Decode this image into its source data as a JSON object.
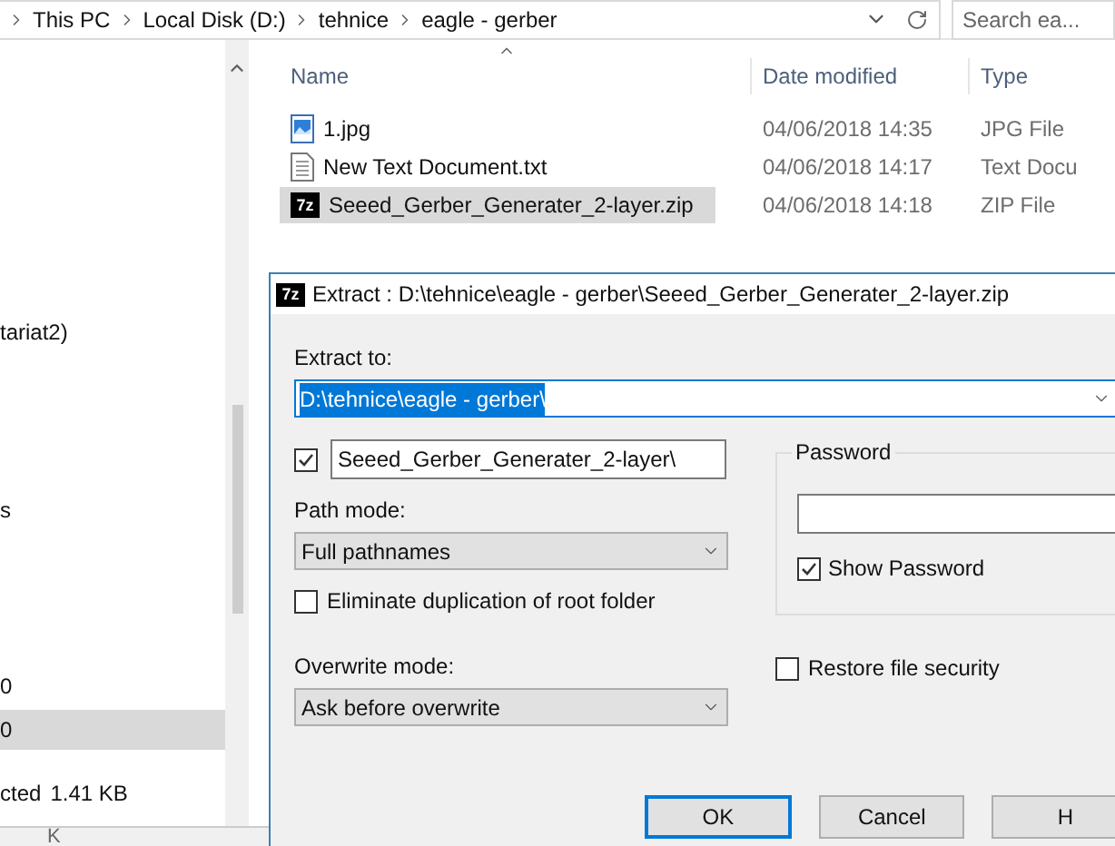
{
  "breadcrumb": [
    "This PC",
    "Local Disk (D:)",
    "tehnice",
    "eagle - gerber"
  ],
  "search": {
    "placeholder": "Search ea..."
  },
  "navigation": {
    "items": [
      {
        "label": "tariat2)",
        "selected": false
      },
      {
        "label": "s",
        "selected": false
      },
      {
        "label": "0",
        "selected": false
      },
      {
        "label": "0",
        "selected": true
      }
    ]
  },
  "status_bar": {
    "selection": "cted",
    "size": "1.41 KB"
  },
  "bottom_strip": {
    "text": "K"
  },
  "file_list": {
    "columns": [
      "Name",
      "Date modified",
      "Type"
    ],
    "rows": [
      {
        "kind": "image",
        "name": "1.jpg",
        "date": "04/06/2018 14:35",
        "type": "JPG File",
        "selected": false
      },
      {
        "kind": "text",
        "name": "New Text Document.txt",
        "date": "04/06/2018 14:17",
        "type": "Text Docu",
        "selected": false
      },
      {
        "kind": "archive",
        "icon_text": "7z",
        "name": "Seeed_Gerber_Generater_2-layer.zip",
        "date": "04/06/2018 14:18",
        "type": "ZIP File",
        "selected": true
      }
    ]
  },
  "dialog": {
    "icon_text": "7z",
    "title": "Extract : D:\\tehnice\\eagle - gerber\\Seeed_Gerber_Generater_2-layer.zip",
    "extract_to": {
      "label": "Extract to:",
      "value": "D:\\tehnice\\eagle - gerber\\"
    },
    "subfolder": {
      "checked": true,
      "value": "Seeed_Gerber_Generater_2-layer\\"
    },
    "path_mode": {
      "label": "Path mode:",
      "value": "Full pathnames"
    },
    "eliminate_duplication": {
      "label": "Eliminate duplication of root folder",
      "checked": false
    },
    "overwrite_mode": {
      "label": "Overwrite mode:",
      "value": "Ask before overwrite"
    },
    "password": {
      "label": "Password",
      "show_password": {
        "label": "Show Password",
        "checked": true
      }
    },
    "restore_security": {
      "label": "Restore file security",
      "checked": false
    },
    "buttons": [
      "OK",
      "Cancel",
      "H"
    ]
  }
}
